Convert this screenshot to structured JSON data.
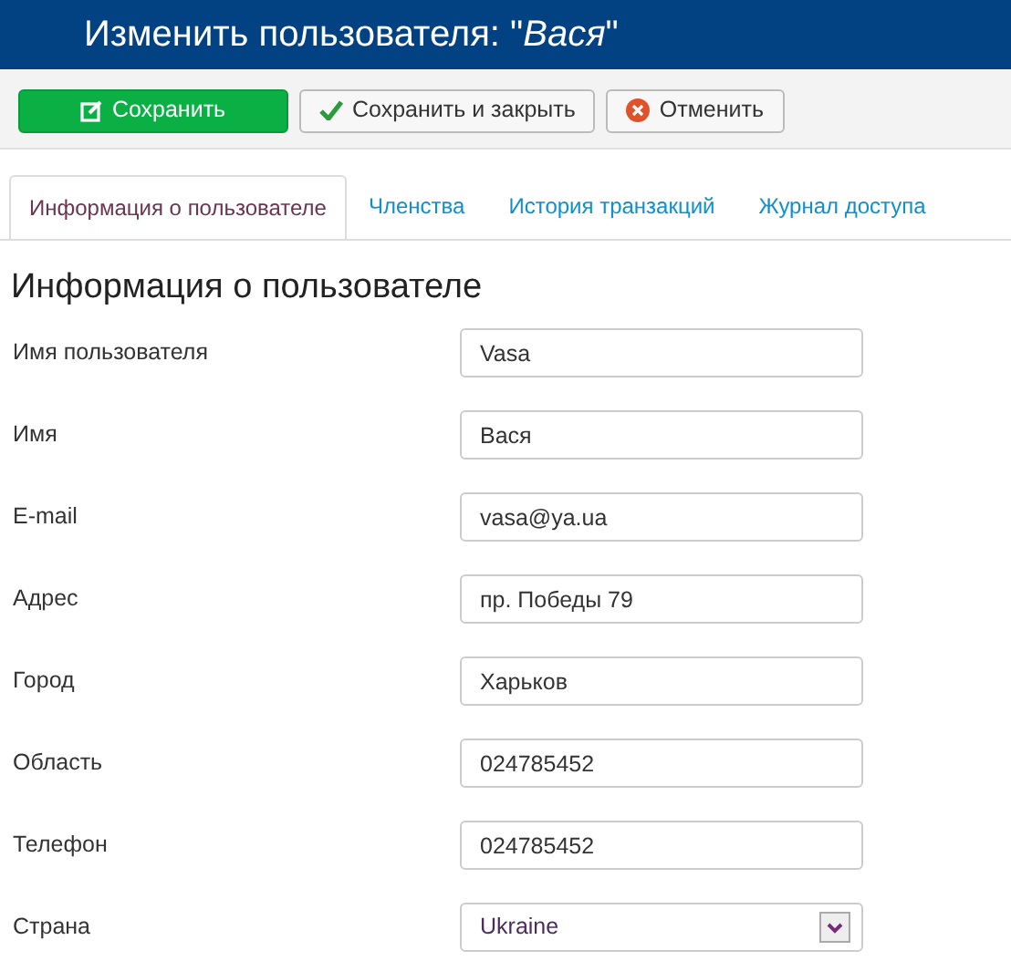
{
  "header": {
    "title": "Изменить пользователя: \"*Вася*\""
  },
  "toolbar": [
    {
      "label": "Сохранить",
      "kind": "save"
    },
    {
      "label": "Сохранить и закрыть",
      "kind": "check"
    },
    {
      "label": "Отменить",
      "kind": "cancel"
    }
  ],
  "tabs": [
    {
      "label": "Информация о пользователе",
      "selected": true
    },
    {
      "label": "Членства",
      "selected": false
    },
    {
      "label": "История транзакций",
      "selected": false
    },
    {
      "label": "Журнал доступа",
      "selected": false
    }
  ],
  "section_title": "Информация о пользователе",
  "fields": [
    {
      "label": "Имя пользователя",
      "value": "Vasa",
      "kind": "text"
    },
    {
      "label": "Имя",
      "value": "Вася",
      "kind": "text"
    },
    {
      "label": "E-mail",
      "value": "vasa@ya.ua",
      "kind": "text"
    },
    {
      "label": "Адрес",
      "value": "пр. Победы 79",
      "kind": "text"
    },
    {
      "label": "Город",
      "value": "Харьков",
      "kind": "text"
    },
    {
      "label": "Область",
      "value": "024785452",
      "kind": "text"
    },
    {
      "label": "Телефон",
      "value": "024785452",
      "kind": "text"
    },
    {
      "label": "Страна",
      "value": "Ukraine",
      "kind": "select"
    }
  ]
}
